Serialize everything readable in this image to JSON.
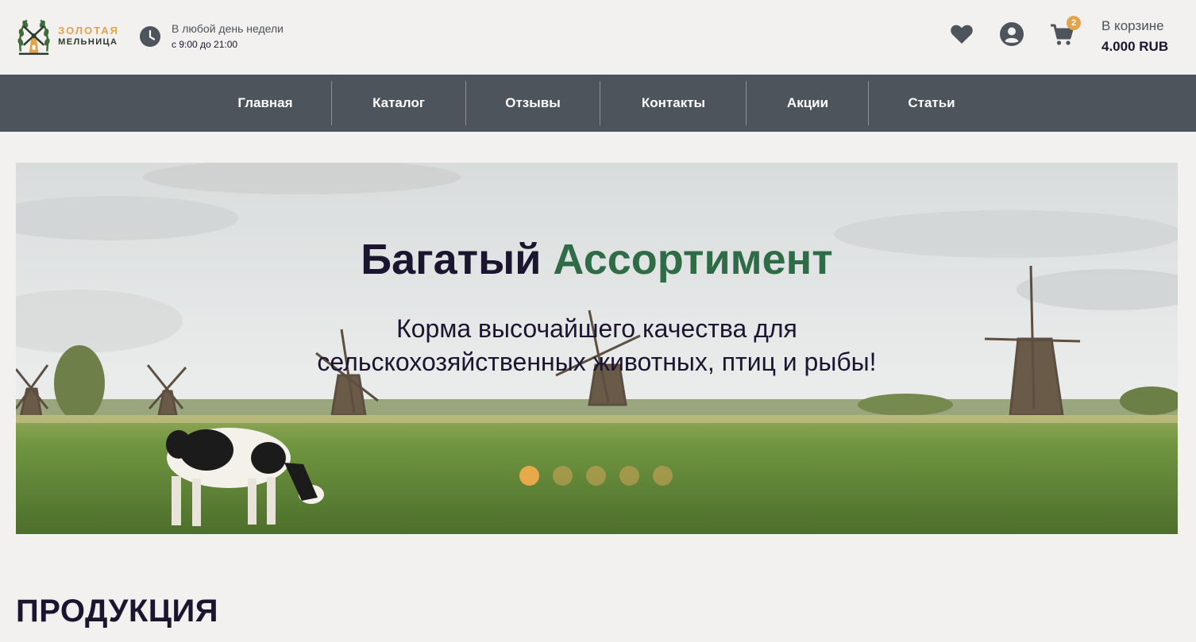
{
  "header": {
    "logo": {
      "line1": "ЗОЛОТАЯ",
      "line2": "МЕЛЬНИЦА"
    },
    "hours": {
      "days": "В любой день недели",
      "time": "с 9:00 до 21:00",
      "icon": "clock-icon"
    },
    "icons": [
      "heart-icon",
      "user-icon",
      "cart-icon"
    ],
    "cart": {
      "badge": "2",
      "label": "В корзине",
      "total": "4.000 RUB"
    }
  },
  "nav": {
    "items": [
      {
        "label": "Главная"
      },
      {
        "label": "Каталог"
      },
      {
        "label": "Отзывы"
      },
      {
        "label": "Контакты"
      },
      {
        "label": "Акции"
      },
      {
        "label": "Статьи"
      }
    ]
  },
  "hero": {
    "title_part1": "Багатый",
    "title_part2": "Ассортимент",
    "subtitle_line1": "Корма высочайшего качества для",
    "subtitle_line2": "сельскохозяйственных животных, птиц и рыбы!",
    "slides_count": 5,
    "active_slide": 1
  },
  "section": {
    "title": "ПРОДУКЦИЯ"
  },
  "colors": {
    "background": "#f3f1ef",
    "nav_bg": "#4e545c",
    "accent_orange": "#e2a44a",
    "accent_green": "#2f6b46",
    "text_dark": "#1b1530"
  }
}
